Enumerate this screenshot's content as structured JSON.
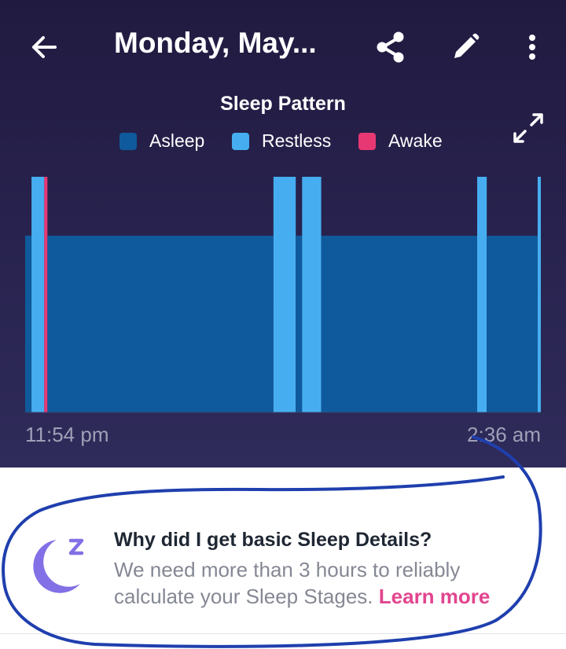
{
  "header": {
    "title": "Monday, May...",
    "back_icon": "arrow-left-icon",
    "share_icon": "share-icon",
    "edit_icon": "pencil-icon",
    "more_icon": "more-vertical-icon"
  },
  "chart_title": "Sleep Pattern",
  "expand_icon": "expand-icon",
  "legend": [
    {
      "label": "Asleep",
      "color": "#0f5a9c"
    },
    {
      "label": "Restless",
      "color": "#46aef0"
    },
    {
      "label": "Awake",
      "color": "#e73873"
    }
  ],
  "chart_data": {
    "type": "area",
    "title": "Sleep Pattern",
    "x_start_label": "11:54 pm",
    "x_end_label": "2:36 am",
    "duration_minutes": 162,
    "categories": [
      "Asleep",
      "Restless",
      "Awake"
    ],
    "segments": [
      {
        "stage": "Asleep",
        "start_min": 0,
        "end_min": 2
      },
      {
        "stage": "Restless",
        "start_min": 2,
        "end_min": 6
      },
      {
        "stage": "Awake",
        "start_min": 6,
        "end_min": 7
      },
      {
        "stage": "Asleep",
        "start_min": 7,
        "end_min": 78
      },
      {
        "stage": "Restless",
        "start_min": 78,
        "end_min": 85
      },
      {
        "stage": "Asleep",
        "start_min": 85,
        "end_min": 87
      },
      {
        "stage": "Restless",
        "start_min": 87,
        "end_min": 93
      },
      {
        "stage": "Asleep",
        "start_min": 93,
        "end_min": 142
      },
      {
        "stage": "Restless",
        "start_min": 142,
        "end_min": 145
      },
      {
        "stage": "Asleep",
        "start_min": 145,
        "end_min": 161
      },
      {
        "stage": "Restless",
        "start_min": 161,
        "end_min": 162
      }
    ]
  },
  "info": {
    "icon": "moon-sleep-icon",
    "icon_color": "#8270e6",
    "title": "Why did I get basic Sleep Details?",
    "body": "We need more than 3 hours to reliably calculate your Sleep Stages. ",
    "link": "Learn more"
  }
}
